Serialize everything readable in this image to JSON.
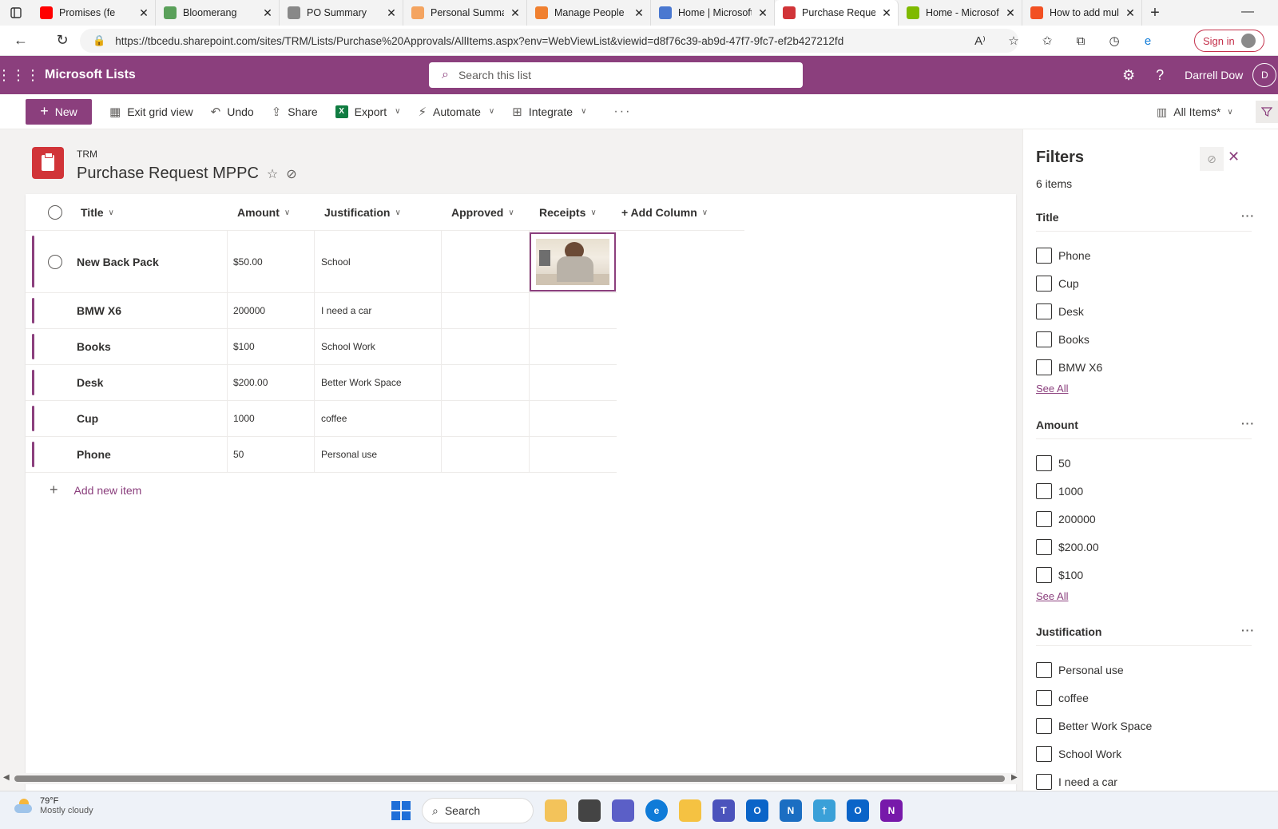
{
  "browser": {
    "tabs": [
      {
        "label": "Promises (fe",
        "color": "#ff0000",
        "active": false
      },
      {
        "label": "Bloomerang",
        "color": "#5aa05a",
        "active": false
      },
      {
        "label": "PO Summary",
        "color": "#888888",
        "active": false
      },
      {
        "label": "Personal Summar",
        "color": "#f4a460",
        "active": false
      },
      {
        "label": "Manage People",
        "color": "#f08030",
        "active": false
      },
      {
        "label": "Home | Microsoft",
        "color": "#4a78d0",
        "active": false
      },
      {
        "label": "Purchase Request",
        "color": "#d13438",
        "active": true
      },
      {
        "label": "Home - Microsof",
        "color": "#7fba00",
        "active": false
      },
      {
        "label": "How to add mult",
        "color": "#f25022",
        "active": false
      }
    ],
    "url": "https://tbcedu.sharepoint.com/sites/TRM/Lists/Purchase%20Approvals/AllItems.aspx?env=WebViewList&viewid=d8f76c39-ab9d-47f7-9fc7-ef2b427212fd",
    "signin_label": "Sign in"
  },
  "suite": {
    "app_name": "Microsoft Lists",
    "search_placeholder": "Search this list",
    "user_name": "Darrell Dow",
    "user_initial": "D",
    "accent_color": "#8b3f7d"
  },
  "commands": {
    "new": "New",
    "exit_grid": "Exit grid view",
    "undo": "Undo",
    "share": "Share",
    "export": "Export",
    "automate": "Automate",
    "integrate": "Integrate",
    "more": "···",
    "view": "All Items*"
  },
  "list": {
    "site": "TRM",
    "title": "Purchase Request MPPC",
    "columns": {
      "title": "Title",
      "amount": "Amount",
      "justification": "Justification",
      "approved": "Approved",
      "receipts": "Receipts",
      "add_column": "+ Add Column"
    },
    "rows": [
      {
        "title": "New Back Pack",
        "amount": "$50.00",
        "justification": "School",
        "approved": "",
        "has_receipt": true
      },
      {
        "title": "BMW X6",
        "amount": "200000",
        "justification": "I need a car",
        "approved": "",
        "has_receipt": false
      },
      {
        "title": "Books",
        "amount": "$100",
        "justification": "School Work",
        "approved": "",
        "has_receipt": false
      },
      {
        "title": "Desk",
        "amount": "$200.00",
        "justification": "Better Work Space",
        "approved": "",
        "has_receipt": false
      },
      {
        "title": "Cup",
        "amount": "1000",
        "justification": "coffee",
        "approved": "",
        "has_receipt": false
      },
      {
        "title": "Phone",
        "amount": "50",
        "justification": "Personal use",
        "approved": "",
        "has_receipt": false
      }
    ],
    "add_new_item": "Add new item"
  },
  "filters": {
    "heading": "Filters",
    "count": "6 items",
    "sections": [
      {
        "name": "Title",
        "options": [
          "Phone",
          "Cup",
          "Desk",
          "Books",
          "BMW X6"
        ],
        "see_all": "See All"
      },
      {
        "name": "Amount",
        "options": [
          "50",
          "1000",
          "200000",
          "$200.00",
          "$100"
        ],
        "see_all": "See All"
      },
      {
        "name": "Justification",
        "options": [
          "Personal use",
          "coffee",
          "Better Work Space",
          "School Work",
          "I need a car"
        ],
        "see_all": ""
      }
    ]
  },
  "taskbar": {
    "temp": "79°F",
    "condition": "Mostly cloudy",
    "search": "Search"
  }
}
